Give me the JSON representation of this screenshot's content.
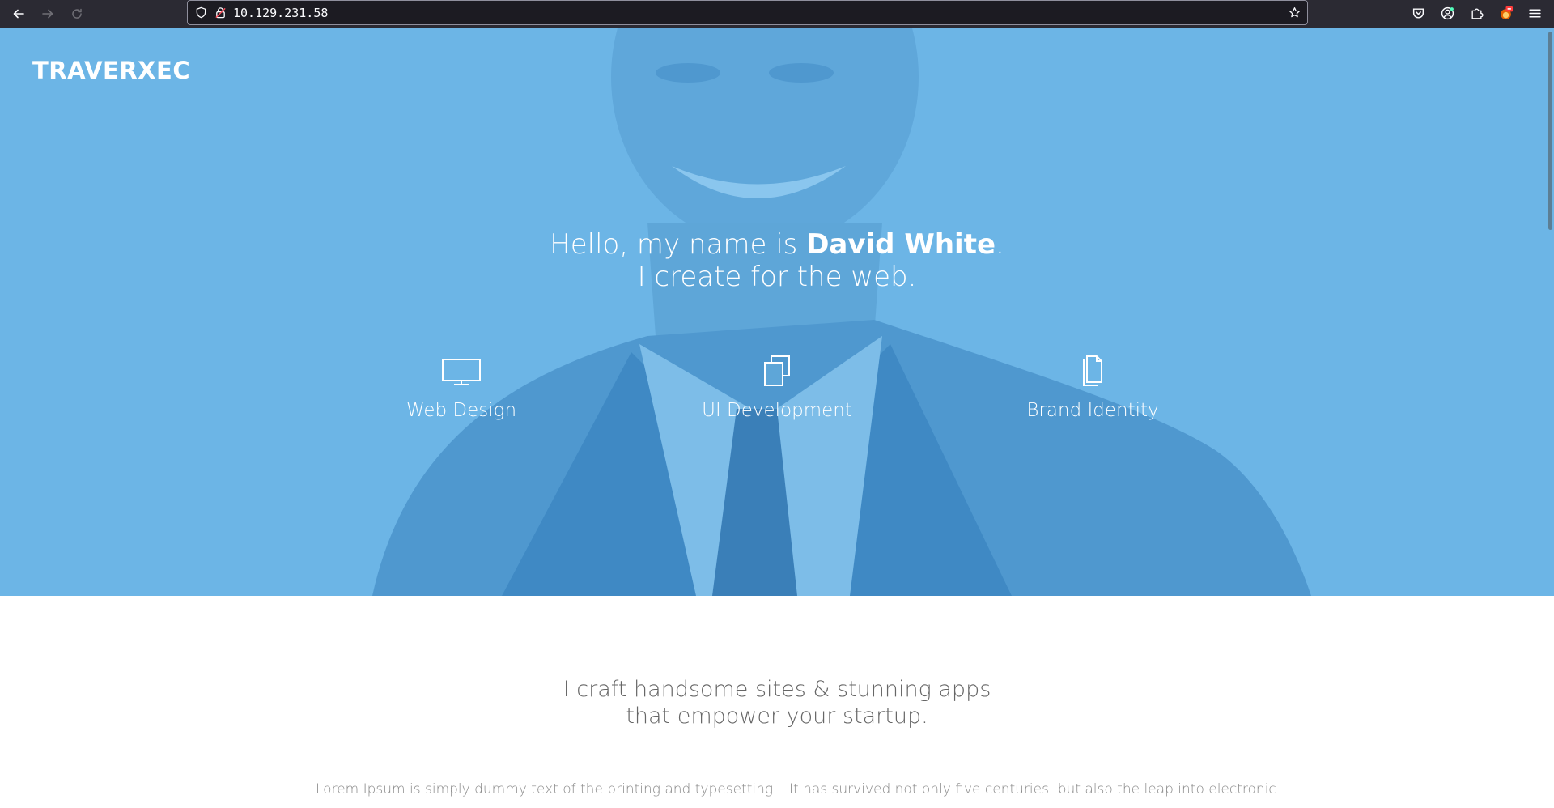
{
  "browser": {
    "url": "10.129.231.58",
    "icons": {
      "back": "arrow-left-icon",
      "forward": "arrow-right-icon",
      "reload": "reload-icon",
      "tracking": "shield-icon",
      "lock": "insecure-lock-icon",
      "bookmark": "star-icon",
      "pocket": "pocket-icon",
      "account": "account-icon",
      "extensions": "puzzle-icon",
      "extension_badge": "fox-extension-icon",
      "menu": "hamburger-menu-icon"
    }
  },
  "site": {
    "brand": "TRAVERXEC",
    "headline": {
      "prefix": "Hello, my name is ",
      "name": "David White",
      "suffix": ".",
      "line2": "I create for the web."
    },
    "services": [
      {
        "label": "Web Design",
        "icon": "monitor-icon"
      },
      {
        "label": "UI Development",
        "icon": "stacked-windows-icon"
      },
      {
        "label": "Brand Identity",
        "icon": "documents-icon"
      }
    ],
    "tagline": {
      "line1": "I craft handsome sites & stunning apps",
      "line2": "that empower your startup."
    },
    "paragraphs": {
      "left": "Lorem Ipsum is simply dummy text of the printing and typesetting",
      "right": "It has survived not only five centuries, but also the leap into electronic"
    }
  },
  "colors": {
    "hero_overlay": "#6cb5e6",
    "chrome_bg": "#2b2a33",
    "urlbar_bg": "#1c1b22",
    "tagline_text": "#666666"
  }
}
